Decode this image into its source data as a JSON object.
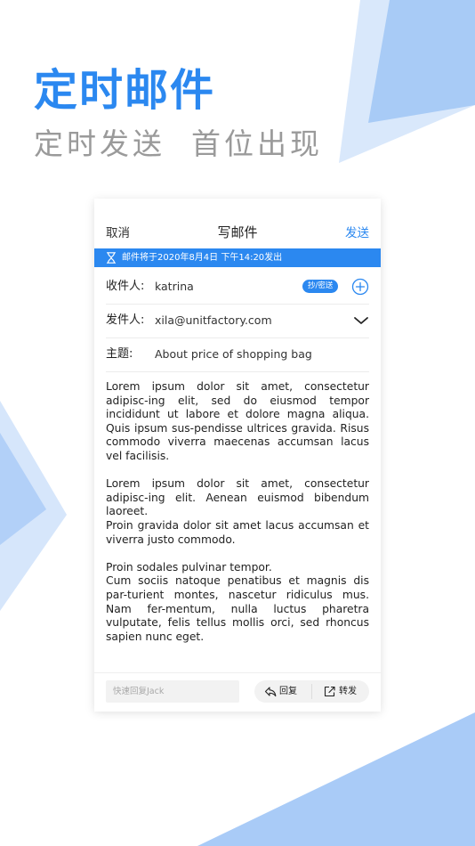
{
  "promo": {
    "headline": "定时邮件",
    "subheadline": "定时发送  首位出现"
  },
  "nav": {
    "cancel_label": "取消",
    "title": "写邮件",
    "send_label": "发送"
  },
  "schedule_banner": {
    "text": "邮件将于2020年8月4日 下午14:20发出"
  },
  "recipient": {
    "label": "收件人:",
    "value": "katrina",
    "cc_bcc_label": "抄/密送"
  },
  "sender": {
    "label": "发件人:",
    "value": "xila@unitfactory.com"
  },
  "subject": {
    "label": "主题:",
    "value": "About price of shopping bag"
  },
  "body": {
    "paragraphs": [
      "Lorem ipsum dolor sit amet, consectetur adipisc-ing elit, sed do eiusmod tempor incididunt ut labore et dolore magna aliqua. Quis ipsum sus-pendisse ultrices gravida. Risus commodo viverra maecenas accumsan lacus vel facilisis.",
      "Lorem ipsum dolor sit amet, consectetur adipisc-ing elit. Aenean euismod bibendum laoreet.",
      "Proin gravida dolor sit amet lacus accumsan et viverra justo commodo.",
      "Proin sodales pulvinar tempor.",
      "Cum sociis natoque penatibus et magnis dis par-turient montes, nascetur ridiculus mus. Nam fer-mentum, nulla luctus pharetra vulputate, felis tellus mollis orci, sed rhoncus sapien nunc eget."
    ]
  },
  "bottom_bar": {
    "quick_reply_placeholder": "快速回复Jack",
    "reply_label": "回复",
    "forward_label": "转发"
  },
  "colors": {
    "accent": "#2b88f0",
    "decor_light": "#d6e6fb",
    "decor_mid": "#a9cbf7"
  },
  "icons": {
    "banner": "hourglass-icon",
    "add_recipient": "plus-circle-icon",
    "sender_dropdown": "chevron-down-icon",
    "reply": "reply-arrow-icon",
    "forward": "forward-share-icon"
  }
}
